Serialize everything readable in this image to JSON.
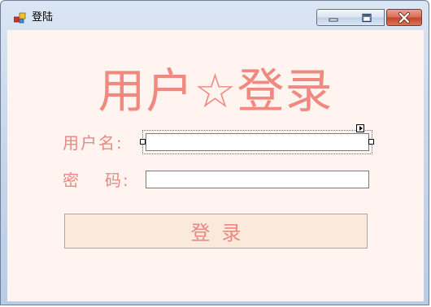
{
  "window": {
    "title": "登陆",
    "icon": "winforms-app-icon",
    "controls": [
      "minimize-icon",
      "maximize-icon",
      "close-icon"
    ]
  },
  "form": {
    "heading": "用户☆登录",
    "username_label": "用户名:",
    "password_label_first": "密",
    "password_label_second": "码:",
    "username_value": "",
    "password_value": "",
    "login_button": "登录"
  },
  "colors": {
    "accent_text": "#ea8882",
    "form_background": "#fff4f0",
    "button_background": "#fbe9dc"
  }
}
